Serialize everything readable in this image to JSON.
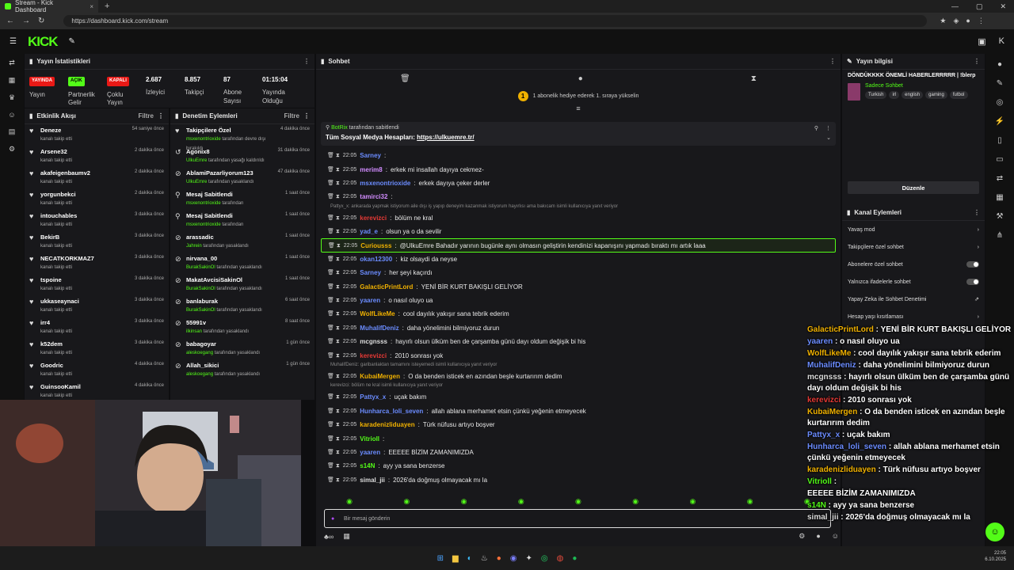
{
  "browser": {
    "tab_title": "Stream - Kick Dashboard",
    "url": "https://dashboard.kick.com/stream"
  },
  "brand": {
    "logo_text": "KICK",
    "accent": "#53fc18"
  },
  "stats": {
    "title": "Yayın İstatistikleri",
    "items": [
      {
        "badge": "YAYINDA",
        "badge_color": "#e91916",
        "label": "Yayın"
      },
      {
        "badge": "AÇIK",
        "badge_color": "#53fc18",
        "label": "Partnerlik Gelir"
      },
      {
        "badge": "KAPALI",
        "badge_color": "#e91916",
        "label": "Çoklu Yayın"
      },
      {
        "value": "2.687",
        "label": "İzleyici"
      },
      {
        "value": "8.857",
        "label": "Takipçi"
      },
      {
        "value": "87",
        "label": "Abone Sayısı"
      },
      {
        "value": "01:15:04",
        "label": "Yayında Olduğu"
      }
    ]
  },
  "activity": {
    "title": "Etkinlik Akışı",
    "filter": "Filtre",
    "items": [
      {
        "name": "Deneze",
        "action": "kanalı takip etti",
        "time": "54 saniye önce"
      },
      {
        "name": "Arsene32",
        "action": "kanalı takip etti",
        "time": "2 dakika önce"
      },
      {
        "name": "akafeigenbaumv2",
        "action": "kanalı takip etti",
        "time": "2 dakika önce"
      },
      {
        "name": "yorgunbekci",
        "action": "kanalı takip etti",
        "time": "2 dakika önce"
      },
      {
        "name": "intouchables",
        "action": "kanalı takip etti",
        "time": "3 dakika önce"
      },
      {
        "name": "BekirB",
        "action": "kanalı takip etti",
        "time": "3 dakika önce"
      },
      {
        "name": "NECATKORKMAZ7",
        "action": "kanalı takip etti",
        "time": "3 dakika önce"
      },
      {
        "name": "tspoine",
        "action": "kanalı takip etti",
        "time": "3 dakika önce"
      },
      {
        "name": "ukkaseaynaci",
        "action": "kanalı takip etti",
        "time": "3 dakika önce"
      },
      {
        "name": "irr4",
        "action": "kanalı takip etti",
        "time": "3 dakika önce"
      },
      {
        "name": "k52dem",
        "action": "kanalı takip etti",
        "time": "3 dakika önce"
      },
      {
        "name": "Goodric",
        "action": "kanalı takip etti",
        "time": "4 dakika önce"
      },
      {
        "name": "GuinsooKamil",
        "action": "kanalı takip etti",
        "time": "4 dakika önce"
      }
    ]
  },
  "moderation": {
    "title": "Denetim Eylemleri",
    "filter": "Filtre",
    "items": [
      {
        "icon": "♥",
        "title": "Takipçilere Özel",
        "actor": "msxenontrioxide",
        "action": "tarafından devre dışı bırakıldı",
        "time": "4 dakika önce"
      },
      {
        "icon": "↺",
        "title": "Agonix8",
        "actor": "UlkuEmre",
        "action": "tarafından yasağı kaldırıldı",
        "time": "31 dakika önce"
      },
      {
        "icon": "⊘",
        "title": "AblamiPazarliyorum123",
        "actor": "UlkuEmre",
        "action": "tarafından yasaklandı",
        "time": "47 dakika önce"
      },
      {
        "icon": "⚲",
        "title": "Mesaj Sabitlendi",
        "actor": "msxenontrioxide",
        "action": "tarafından",
        "time": "1 saat önce"
      },
      {
        "icon": "⚲",
        "title": "Mesaj Sabitlendi",
        "actor": "msxenontrioxide",
        "action": "tarafından",
        "time": "1 saat önce"
      },
      {
        "icon": "⊘",
        "title": "arassadic",
        "actor": "Jahrein",
        "action": "tarafından yasaklandı",
        "time": "1 saat önce"
      },
      {
        "icon": "⊘",
        "title": "nirvana_00",
        "actor": "BurakSakinOl",
        "action": "tarafından yasaklandı",
        "time": "1 saat önce"
      },
      {
        "icon": "⊘",
        "title": "MakatAvcisiSakinOl",
        "actor": "BurakSakinOl",
        "action": "tarafından yasaklandı",
        "time": "1 saat önce"
      },
      {
        "icon": "⊘",
        "title": "banlaburak",
        "actor": "BurakSakinOl",
        "action": "tarafından yasaklandı",
        "time": "6 saat önce"
      },
      {
        "icon": "⊘",
        "title": "55991v",
        "actor": "ilkinsan",
        "action": "tarafından yasaklandı",
        "time": "8 saat önce"
      },
      {
        "icon": "⊘",
        "title": "babagoyar",
        "actor": "aleskoegang",
        "action": "tarafından yasaklandı",
        "time": "1 gün önce"
      },
      {
        "icon": "⊘",
        "title": "Allah_sikici",
        "actor": "aleskoegang",
        "action": "tarafından yasaklandı",
        "time": "1 gün önce"
      }
    ]
  },
  "chat": {
    "title": "Sohbet",
    "gift_text": "1 abonelik hediye ederek 1. sıraya yükselin",
    "gift_count": "1",
    "pinned_by": "BotRix",
    "pinned_by_suffix": "tarafından sabitlendi",
    "pinned_text": "Tüm Sosyal Medya Hesapları:",
    "pinned_link": "https://ulkuemre.tr/",
    "messages": [
      {
        "time": "22:05",
        "user": "Sarney",
        "color": "#6b8cff",
        "text": ""
      },
      {
        "time": "22:05",
        "user": "merim8",
        "color": "#d28cff",
        "text": "erkek mi insallah dayıya cekmez-"
      },
      {
        "time": "22:05",
        "user": "msxenontrioxide",
        "color": "#6b8cff",
        "text": "erkek dayıya çeker derler"
      },
      {
        "time": "22:05",
        "user": "tamirci32",
        "color": "#d28cff",
        "text": ""
      },
      {
        "reply": "Pattyx_x: ankarada yapmak istiyorum aile dışı iş yapıp deneyim kazanmak istiyorum hayırlısı ama bakıcam isimli kullanıcıya yanıt veriyor"
      },
      {
        "time": "22:05",
        "user": "kerevizci",
        "color": "#e53935",
        "text": "bölüm ne kral"
      },
      {
        "time": "22:05",
        "user": "yad_e",
        "color": "#6b8cff",
        "text": "olsun ya o da sevilir"
      },
      {
        "time": "22:05",
        "user": "Curiousss",
        "color": "#f0b100",
        "text": "@UlkuEmre Bahadır yarının bugünle aynı olmasın geliştirin kendinizi kapanışını yapmadı bıraktı mı artık laaa",
        "highlight": true
      },
      {
        "time": "22:05",
        "user": "okan12300",
        "color": "#6b8cff",
        "text": "kiz olsaydi da neyse"
      },
      {
        "time": "22:05",
        "user": "Sarney",
        "color": "#6b8cff",
        "text": "her şeyi kaçırdı"
      },
      {
        "time": "22:05",
        "user": "GalacticPrintLord",
        "color": "#f0b100",
        "text": "YENİ BİR KURT BAKIŞLI GELİYOR"
      },
      {
        "time": "22:05",
        "user": "yaaren",
        "color": "#6b8cff",
        "text": "o nasıl oluyo ua"
      },
      {
        "time": "22:05",
        "user": "WolfLikeMe",
        "color": "#f0b100",
        "text": "cool dayılık yakışır sana tebrik ederim"
      },
      {
        "time": "22:05",
        "user": "MuhalifDeniz",
        "color": "#6b8cff",
        "text": "daha yönelimini bilmiyoruz durun"
      },
      {
        "time": "22:05",
        "user": "mcgnsss",
        "color": "#dddddd",
        "text": "hayırlı olsun ülküm ben de çarşamba günü dayı oldum değişik bi his"
      },
      {
        "time": "22:05",
        "user": "kerevizci",
        "color": "#e53935",
        "text": "2010 sonrası yok"
      },
      {
        "reply": "MuhalifDeniz: garibanlaktan tamamını isteyemedi isimli kullanıcıya yanıt veriyor"
      },
      {
        "time": "22:05",
        "user": "KubaiMergen",
        "color": "#f0b100",
        "text": "O da benden isticek en azından beşle kurtarırım dedim"
      },
      {
        "reply": "kerevizci: bölüm ne kral isimli kullanıcıya yanıt veriyor"
      },
      {
        "time": "22:05",
        "user": "Pattyx_x",
        "color": "#6b8cff",
        "text": "uçak bakım"
      },
      {
        "time": "22:05",
        "user": "Hunharca_loli_seven",
        "color": "#6b8cff",
        "text": "allah ablana merhamet etsin çünkü yeğenin etmeyecek"
      },
      {
        "time": "22:05",
        "user": "karadenizliduayen",
        "color": "#f0b100",
        "text": "Türk nüfusu artıyo boşver"
      },
      {
        "time": "22:05",
        "user": "Vitrioll",
        "color": "#53fc18",
        "text": ""
      },
      {
        "time": "22:05",
        "user": "yaaren",
        "color": "#6b8cff",
        "text": "EEEEE BİZİM ZAMANIMIZDA"
      },
      {
        "time": "22:05",
        "user": "s14N",
        "color": "#53fc18",
        "text": "ayy ya sana benzerse"
      },
      {
        "time": "22:05",
        "user": "simal_jii",
        "color": "#dddddd",
        "text": "2026'da doğmuş olmayacak mı la"
      }
    ],
    "input_placeholder": "Bir mesaj gönderin"
  },
  "stream_info": {
    "title": "Yayın bilgisi",
    "stream_title": "DÖNDÜKKKK ÖNEMLİ HABERLERRRRR | !blerp",
    "category": "Sadece Sohbet",
    "tags": [
      "Turkish",
      "irl",
      "english",
      "gaming",
      "futbol"
    ],
    "edit_label": "Düzenle"
  },
  "channel_actions": {
    "title": "Kanal Eylemleri",
    "items": [
      {
        "label": "Yavaş mod",
        "kind": "arrow"
      },
      {
        "label": "Takipçilere özel sohbet",
        "kind": "arrow"
      },
      {
        "label": "Abonelere özel sohbet",
        "kind": "toggle"
      },
      {
        "label": "Yalnızca ifadelerle sohbet",
        "kind": "toggle"
      },
      {
        "label": "Yapay Zeka ile Sohbet Denetimi",
        "kind": "ext"
      },
      {
        "label": "Hesap yaşı kısıtlaması",
        "kind": "arrow"
      }
    ]
  },
  "overlay": [
    {
      "user": "GalacticPrintLord",
      "color": "#f0b100",
      "text": "YENİ BİR KURT BAKIŞLI GELİYOR"
    },
    {
      "user": "yaaren",
      "color": "#6b8cff",
      "text": "o nasıl oluyo ua"
    },
    {
      "user": "WolfLikeMe",
      "color": "#f0b100",
      "text": "cool dayılık yakışır sana tebrik ederim"
    },
    {
      "user": "MuhalifDeniz",
      "color": "#6b8cff",
      "text": "daha yönelimini bilmiyoruz durun"
    },
    {
      "user": "mcgnsss",
      "color": "#dddddd",
      "text": "hayırlı olsun ülküm ben de çarşamba günü dayı oldum değişik bi his"
    },
    {
      "user": "kerevizci",
      "color": "#e53935",
      "text": "2010 sonrası yok"
    },
    {
      "user": "KubaiMergen",
      "color": "#f0b100",
      "text": "O da benden isticek en azından beşle kurtarırım dedim"
    },
    {
      "user": "Pattyx_x",
      "color": "#6b8cff",
      "text": "uçak bakım"
    },
    {
      "user": "Hunharca_loli_seven",
      "color": "#6b8cff",
      "text": "allah ablana merhamet etsin çünkü yeğenin etmeyecek"
    },
    {
      "user": "karadenizliduayen",
      "color": "#f0b100",
      "text": "Türk nüfusu artıyo boşver"
    },
    {
      "user": "Vitrioll",
      "color": "#53fc18",
      "text": ""
    },
    {
      "user": "",
      "color": "#53fc18",
      "text": "EEEEE BİZİM ZAMANIMIZDA"
    },
    {
      "user": "s14N",
      "color": "#53fc18",
      "text": "ayy ya sana benzerse"
    },
    {
      "user": "simal_jii",
      "color": "#dddddd",
      "text": "2026'da doğmuş olmayacak mı la"
    }
  ],
  "tray": {
    "time": "22:05",
    "date": "6.10.2025"
  }
}
